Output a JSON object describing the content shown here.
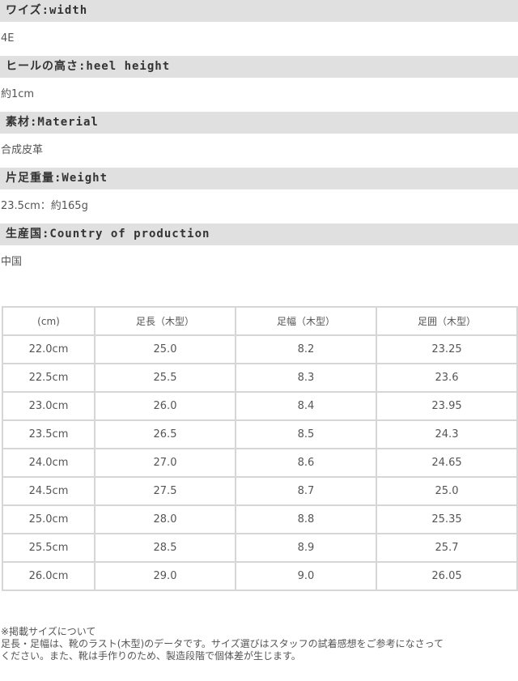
{
  "specs": [
    {
      "label": "ワイズ:width",
      "value": "4E"
    },
    {
      "label": "ヒールの高さ:heel height",
      "value": "約1cm"
    },
    {
      "label": "素材:Material",
      "value": "合成皮革"
    },
    {
      "label": "片足重量:Weight",
      "value": "23.5cm：約165g"
    },
    {
      "label": "生産国:Country of production",
      "value": "中国"
    }
  ],
  "size_table": {
    "headers": [
      "(cm)",
      "足長（木型）",
      "足幅（木型）",
      "足囲（木型）"
    ],
    "rows": [
      [
        "22.0cm",
        "25.0",
        "8.2",
        "23.25"
      ],
      [
        "22.5cm",
        "25.5",
        "8.3",
        "23.6"
      ],
      [
        "23.0cm",
        "26.0",
        "8.4",
        "23.95"
      ],
      [
        "23.5cm",
        "26.5",
        "8.5",
        "24.3"
      ],
      [
        "24.0cm",
        "27.0",
        "8.6",
        "24.65"
      ],
      [
        "24.5cm",
        "27.5",
        "8.7",
        "25.0"
      ],
      [
        "25.0cm",
        "28.0",
        "8.8",
        "25.35"
      ],
      [
        "25.5cm",
        "28.5",
        "8.9",
        "25.7"
      ],
      [
        "26.0cm",
        "29.0",
        "9.0",
        "26.05"
      ]
    ]
  },
  "note": {
    "title": "※掲載サイズについて",
    "line1": "足長・足幅は、靴のラスト(木型)のデータです。サイズ選びはスタッフの試着感想をご参考になさって",
    "line2": "ください。また、靴は手作りのため、製造段階で個体差が生じます。"
  }
}
